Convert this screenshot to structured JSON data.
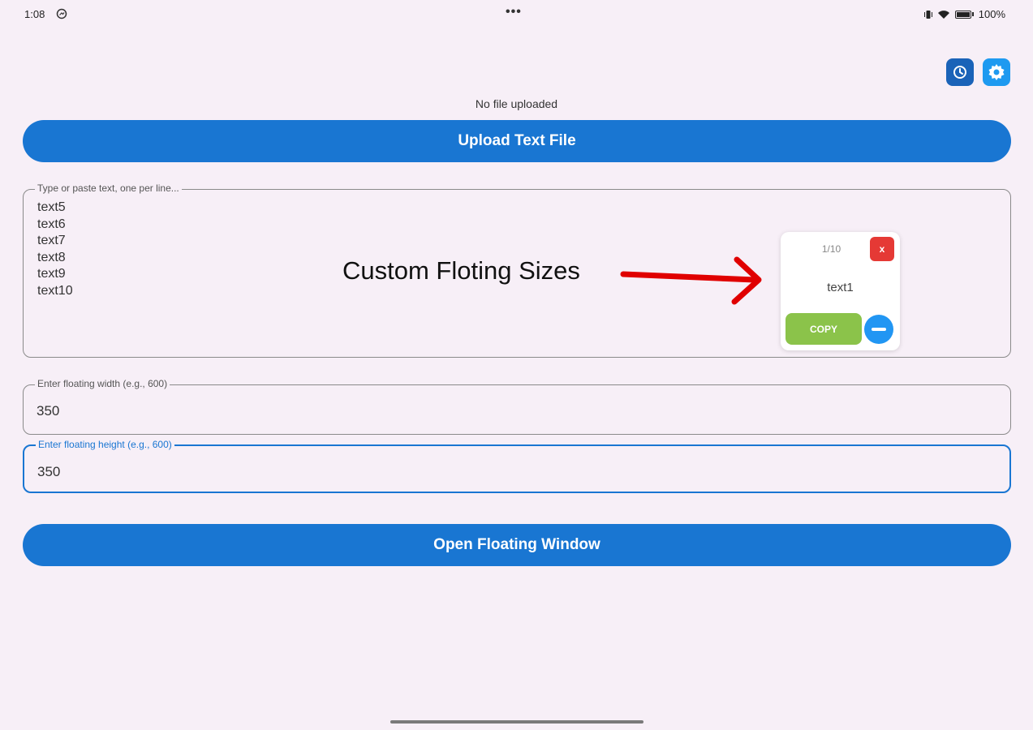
{
  "status_bar": {
    "time": "1:08",
    "battery": "100%"
  },
  "header": {
    "history_icon": "history-icon",
    "settings_icon": "gear-icon"
  },
  "file_status": "No file uploaded",
  "buttons": {
    "upload": "Upload Text File",
    "open": "Open Floating Window"
  },
  "text_input": {
    "label": "Type or paste text, one per line...",
    "lines": [
      "text5",
      "text6",
      "text7",
      "text8",
      "text9",
      "text10"
    ]
  },
  "width_field": {
    "label": "Enter floating width (e.g., 600)",
    "value": "350"
  },
  "height_field": {
    "label": "Enter floating height (e.g., 600)",
    "value": "350"
  },
  "annotation": {
    "text": "Custom Floting Sizes",
    "color": "#e00000"
  },
  "floating_preview": {
    "counter": "1/10",
    "close_label": "x",
    "text": "text1",
    "copy_label": "COPY"
  },
  "colors": {
    "primary": "#1976d2",
    "copy": "#8bc34a",
    "close": "#e53935",
    "background": "#f7eff7"
  }
}
